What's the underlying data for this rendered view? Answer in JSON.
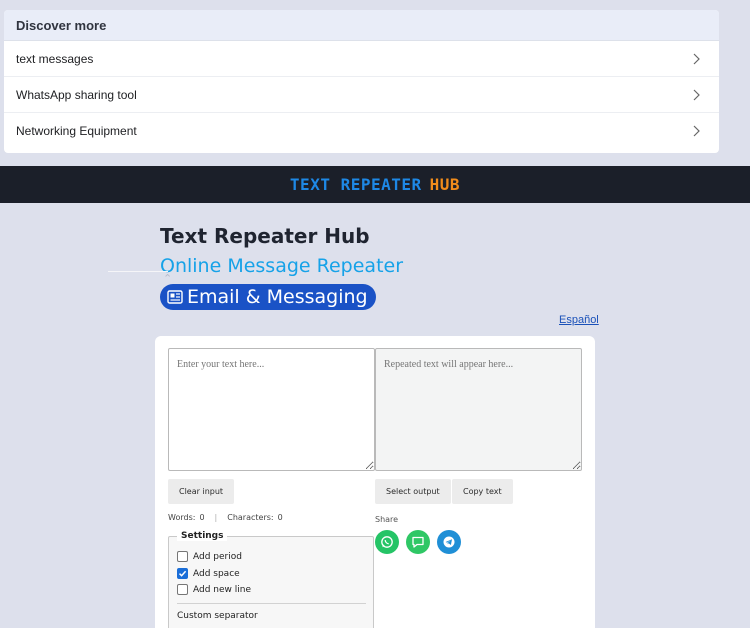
{
  "discover": {
    "title": "Discover more",
    "items": [
      {
        "label": "text messages"
      },
      {
        "label": "WhatsApp sharing tool"
      },
      {
        "label": "Networking Equipment"
      }
    ]
  },
  "brand": {
    "part1": "TEXT REPEATER",
    "part2": "HUB",
    "colors": {
      "part1": "#1e88e5",
      "part2": "#f28c1b",
      "bar": "#1b1f29"
    }
  },
  "hero": {
    "title": "Text Repeater Hub",
    "subtitle": "Online Message Repeater",
    "category_icon": "newspaper-icon",
    "category": "Email & Messaging"
  },
  "language_link": "Español",
  "editor": {
    "input_placeholder": "Enter your text here...",
    "output_placeholder": "Repeated text will appear here...",
    "clear_button": "Clear input",
    "select_button": "Select output",
    "copy_button": "Copy text",
    "words_label": "Words:",
    "words_value": "0",
    "separator": "|",
    "chars_label": "Characters:",
    "chars_value": "0"
  },
  "share": {
    "label": "Share",
    "buttons": [
      {
        "icon": "whatsapp-icon",
        "color": "#25c466"
      },
      {
        "icon": "message-icon",
        "color": "#2fc765"
      },
      {
        "icon": "telegram-icon",
        "color": "#1f8fd6"
      }
    ]
  },
  "settings": {
    "legend": "Settings",
    "options": [
      {
        "label": "Add period",
        "checked": false
      },
      {
        "label": "Add space",
        "checked": true
      },
      {
        "label": "Add new line",
        "checked": false
      }
    ],
    "custom_separator_label": "Custom separator"
  }
}
